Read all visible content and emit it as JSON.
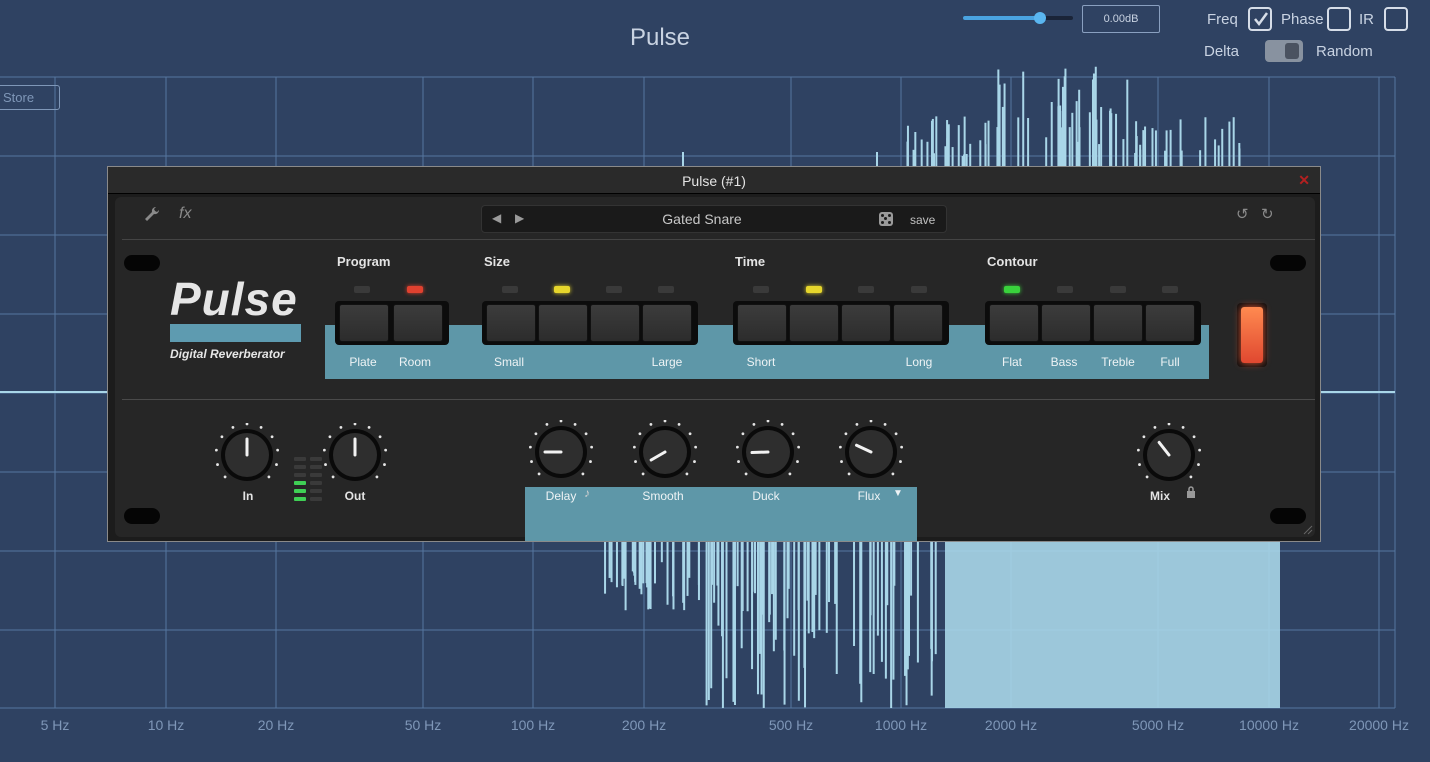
{
  "app": {
    "title": "Pulse",
    "store_label": "Store"
  },
  "analyzer": {
    "freq_axis_labels": [
      "5 Hz",
      "10 Hz",
      "20 Hz",
      "50 Hz",
      "100 Hz",
      "200 Hz",
      "500 Hz",
      "1000 Hz",
      "2000 Hz",
      "5000 Hz",
      "10000 Hz",
      "20000 Hz"
    ],
    "line_color": "#a9d6e8",
    "grid_color": "#5576a0"
  },
  "top_controls": {
    "gain_value": "0.00dB",
    "gain_fraction": 0.7,
    "freq_label": "Freq",
    "freq_checked": true,
    "phase_label": "Phase",
    "phase_checked": false,
    "ir_label": "IR",
    "ir_checked": false,
    "delta_label": "Delta",
    "random_label": "Random"
  },
  "plugin": {
    "window_title": "Pulse (#1)",
    "close_icon": "close-icon",
    "toolbar": {
      "wrench_icon": "wrench-icon",
      "fx_label": "fx",
      "prev_icon": "triangle-left-icon",
      "next_icon": "triangle-right-icon",
      "preset_name": "Gated Snare",
      "dice_icon": "dice-icon",
      "save_label": "save",
      "undo_icon": "undo-icon",
      "redo_icon": "redo-icon"
    },
    "logo": {
      "title": "Pulse",
      "subtitle": "Digital Reverberator"
    },
    "groups": {
      "program": {
        "title": "Program",
        "labels": [
          "Plate",
          "Room"
        ],
        "selected": 1
      },
      "size": {
        "title": "Size",
        "labels": [
          "Small",
          "Large"
        ],
        "selected": 1
      },
      "time": {
        "title": "Time",
        "labels": [
          "Short",
          "Long"
        ],
        "selected": 1
      },
      "contour": {
        "title": "Contour",
        "labels": [
          "Flat",
          "Bass",
          "Treble",
          "Full"
        ],
        "selected": 0
      }
    },
    "led_colors": {
      "program": "#e0412f",
      "size": "#e6d62c",
      "time": "#e6d62c",
      "contour": "#39d23c"
    },
    "knobs": {
      "in": {
        "label": "In"
      },
      "out": {
        "label": "Out"
      },
      "delay": {
        "label": "Delay",
        "icon": "note-icon"
      },
      "smooth": {
        "label": "Smooth"
      },
      "duck": {
        "label": "Duck"
      },
      "flux": {
        "label": "Flux",
        "icon": "dropdown-arrow-icon"
      },
      "mix": {
        "label": "Mix",
        "icon": "lock-icon"
      }
    },
    "meter_lit_segments": 3
  }
}
